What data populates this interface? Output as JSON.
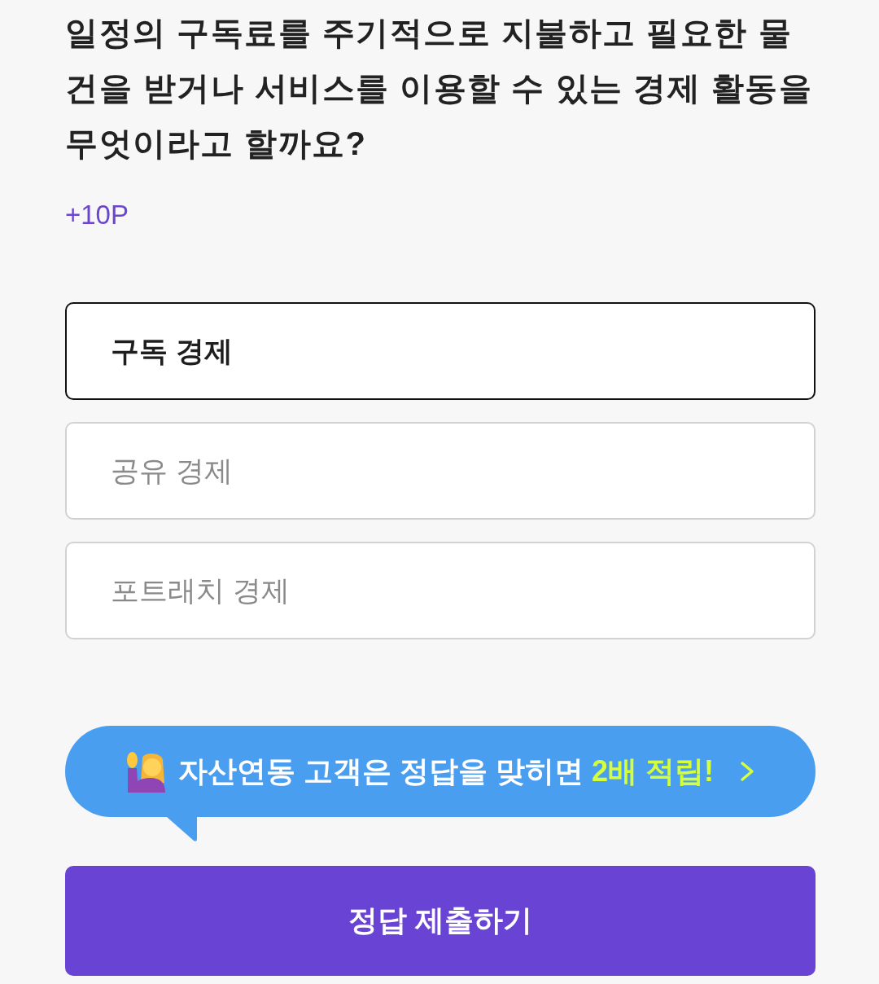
{
  "question": {
    "text": "일정의 구독료를 주기적으로 지불하고 필요한 물건을 받거나 서비스를 이용할 수 있는 경제 활동을 무엇이라고 할까요?"
  },
  "points": "+10P",
  "options": [
    {
      "label": "구독 경제",
      "selected": true
    },
    {
      "label": "공유 경제",
      "selected": false
    },
    {
      "label": "포트래치 경제",
      "selected": false
    }
  ],
  "banner": {
    "text": "자산연동 고객은 정답을 맞히면 **2배 적립!**"
  },
  "submit_button": {
    "label": "정답 제출하기"
  }
}
